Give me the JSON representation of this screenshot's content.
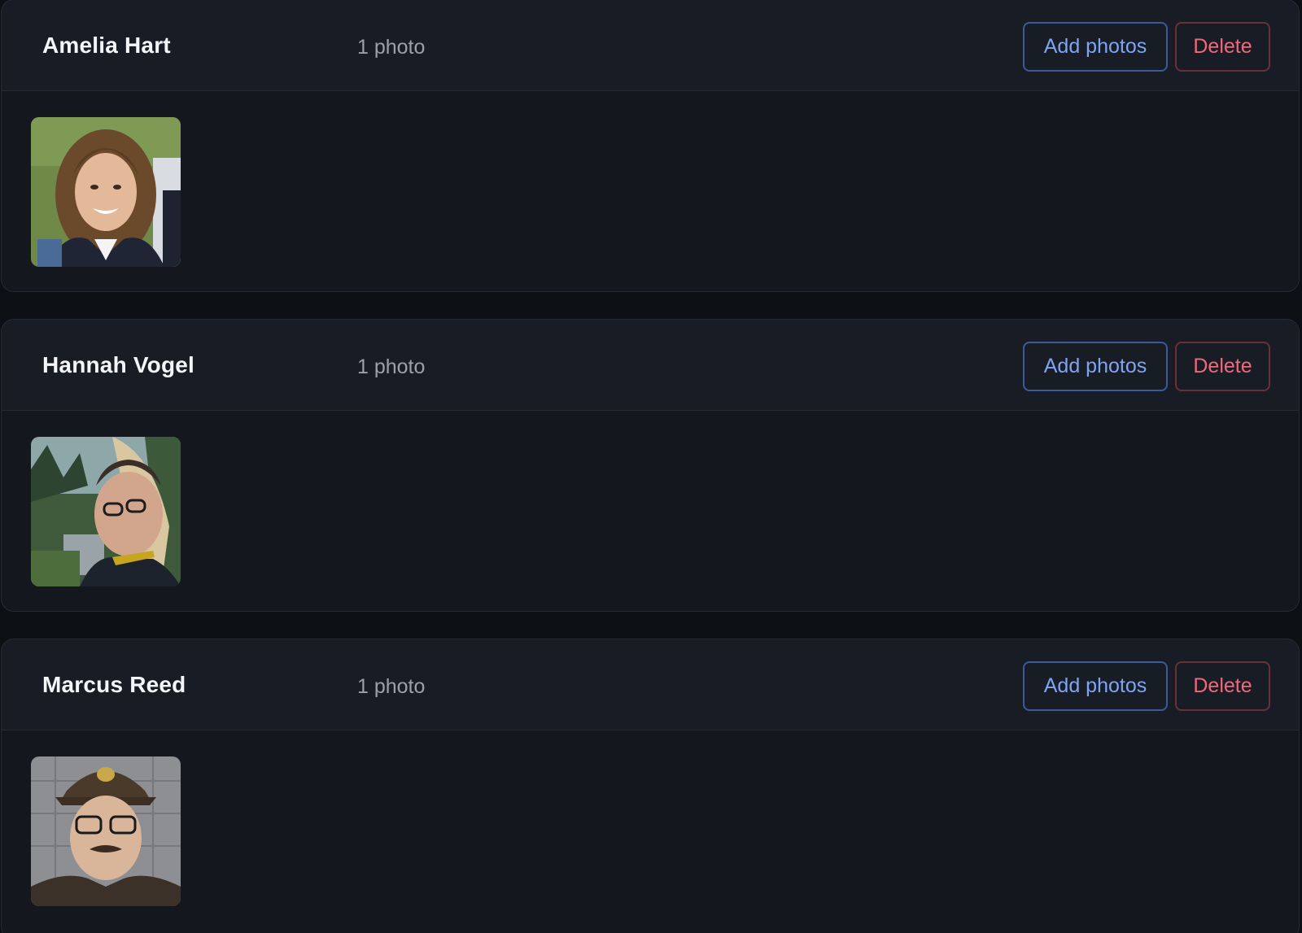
{
  "people": [
    {
      "name": "Amelia Hart",
      "photo_count": "1 photo",
      "add_label": "Add photos",
      "delete_label": "Delete"
    },
    {
      "name": "Hannah Vogel",
      "photo_count": "1 photo",
      "add_label": "Add photos",
      "delete_label": "Delete"
    },
    {
      "name": "Marcus Reed",
      "photo_count": "1 photo",
      "add_label": "Add photos",
      "delete_label": "Delete"
    }
  ],
  "colors": {
    "page_background": "#0c1014",
    "card_background": "#14181e",
    "header_background": "#181d25",
    "add_button_accent": "#7fa4f2",
    "delete_button_accent": "#f0697b"
  }
}
